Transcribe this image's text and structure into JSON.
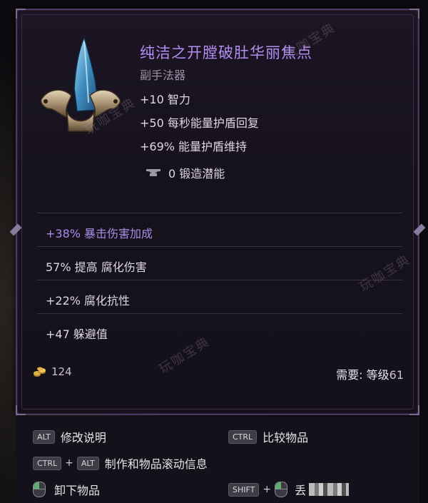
{
  "item": {
    "name": "纯洁之开膛破肚华丽焦点",
    "type": "副手法器",
    "base_stats": [
      "+10 智力",
      "+50 每秒能量护盾回复",
      "+69% 能量护盾维持"
    ],
    "forge_potential": "0 锻造潜能",
    "icon": "focus-offhand-icon"
  },
  "affixes": [
    {
      "text": "+38% 暴击伤害加成",
      "highlight": true
    },
    {
      "text": "57% 提高 腐化伤害",
      "highlight": false
    },
    {
      "text": "+22% 腐化抗性",
      "highlight": false
    },
    {
      "text": "+47 躲避值",
      "highlight": false
    }
  ],
  "footer_info": {
    "gold_value": "124",
    "requirement_label": "需要:",
    "requirement_level_label": "等级",
    "requirement_level": "61"
  },
  "watermark": "玩咖宝典",
  "hints": {
    "edit_description": {
      "key": "ALT",
      "label": "修改说明"
    },
    "compare_items": {
      "key": "CTRL",
      "label": "比较物品"
    },
    "crafting_scroll": {
      "key1": "CTRL",
      "key2": "ALT",
      "label": "制作和物品滚动信息"
    },
    "unequip": {
      "label": "卸下物品"
    },
    "drop": {
      "key": "SHIFT",
      "label": "丢"
    }
  },
  "colors": {
    "item_name": "#b58cf0",
    "highlight_affix": "#a98be8",
    "border": "#4a3860"
  }
}
